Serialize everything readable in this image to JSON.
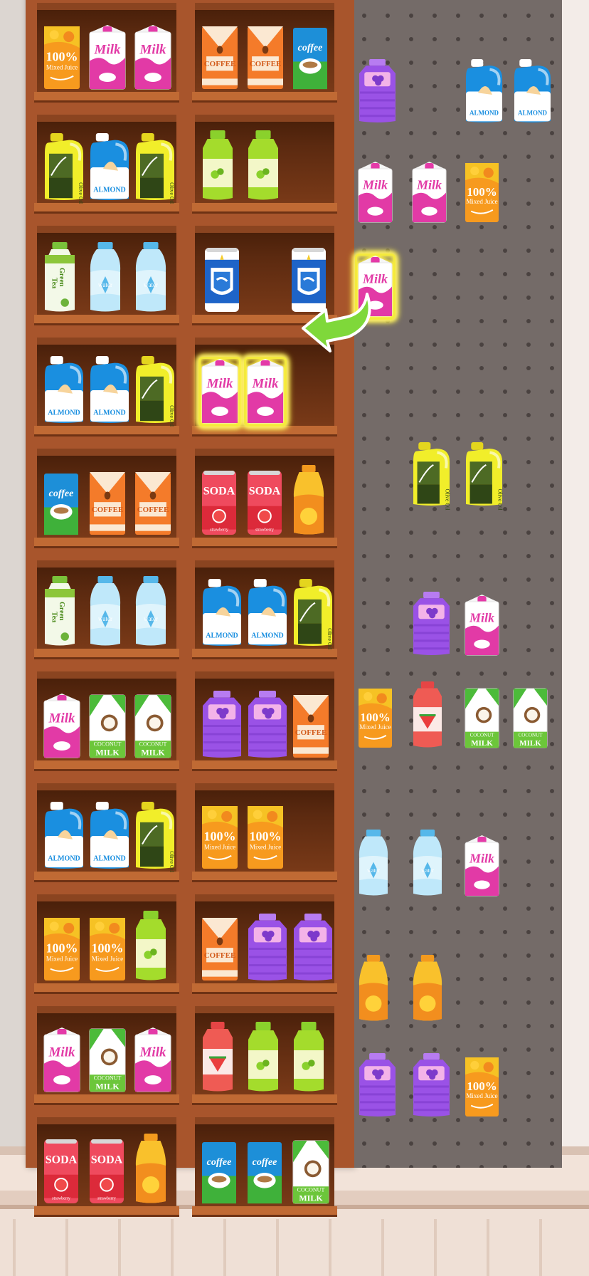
{
  "scene": {
    "name": "grocery-shelf-sort-game",
    "hint": {
      "from": "pegboard-slot-4-1",
      "to": "cabinet-shelf-4-right"
    }
  },
  "colors": {
    "wall": "#e8e2dd",
    "wood": "#a8552c",
    "wood_dark": "#6e3214",
    "wood_inner": "#5c2a10",
    "pegboard": "#746b68",
    "peg_hole": "#4a4240",
    "floor": "#efdfd4",
    "highlight": "#f4ea3c",
    "hint_arrow": "#7fd83a"
  },
  "products": {
    "milk": {
      "label": "Milk",
      "kind": "carton"
    },
    "juice": {
      "label": "100%",
      "sub": "Mixed Juice",
      "kind": "carton"
    },
    "coffee_box": {
      "label": "COFFEE",
      "kind": "carton"
    },
    "coffee_can": {
      "label": "coffee",
      "kind": "box"
    },
    "almond": {
      "label": "ALMOND",
      "kind": "jug"
    },
    "olive_oil": {
      "label": "Olive Oil",
      "kind": "jug"
    },
    "green_juice": {
      "label": "",
      "kind": "bottle"
    },
    "green_tea": {
      "label": "Green Tea",
      "kind": "bottle"
    },
    "water": {
      "label": "water",
      "kind": "bottle"
    },
    "soda": {
      "label": "SODA",
      "sub": "strawberry",
      "kind": "can"
    },
    "energy": {
      "label": "",
      "kind": "can"
    },
    "coconut": {
      "label": "COCONUT MILK",
      "kind": "carton"
    },
    "grape": {
      "label": "",
      "kind": "jug"
    },
    "watermelon": {
      "label": "",
      "kind": "bottle"
    },
    "mango_bottle": {
      "label": "",
      "kind": "bottle"
    }
  },
  "cabinet": {
    "rows": [
      {
        "left": [
          "juice",
          "milk",
          "milk"
        ],
        "right": [
          "coffee_box",
          "coffee_box",
          "coffee_can"
        ]
      },
      {
        "left": [
          "olive_oil",
          "almond",
          "olive_oil"
        ],
        "right": [
          "green_juice",
          "green_juice"
        ]
      },
      {
        "left": [
          "green_tea",
          "water",
          "water"
        ],
        "right": [
          "energy",
          "energy"
        ],
        "right_layout": "split"
      },
      {
        "left": [
          "almond",
          "almond",
          "olive_oil"
        ],
        "right": [
          "milk",
          "milk"
        ],
        "right_highlight": true
      },
      {
        "left": [
          "coffee_can",
          "coffee_box",
          "coffee_box"
        ],
        "right": [
          "soda",
          "soda",
          "mango_bottle"
        ]
      },
      {
        "left": [
          "green_tea",
          "water",
          "water"
        ],
        "right": [
          "almond",
          "almond",
          "olive_oil"
        ]
      },
      {
        "left": [
          "milk",
          "coconut",
          "coconut"
        ],
        "right": [
          "grape",
          "grape",
          "coffee_box"
        ]
      },
      {
        "left": [
          "almond",
          "almond",
          "olive_oil"
        ],
        "right": [
          "juice",
          "juice"
        ]
      },
      {
        "left": [
          "juice",
          "juice",
          "green_juice"
        ],
        "right": [
          "coffee_box",
          "grape",
          "grape"
        ]
      },
      {
        "left": [
          "milk",
          "coconut",
          "milk"
        ],
        "right": [
          "watermelon",
          "green_juice",
          "green_juice"
        ]
      },
      {
        "left": [
          "soda",
          "soda",
          "mango_bottle"
        ],
        "right": [
          "coffee_can",
          "coffee_can",
          "coconut"
        ]
      }
    ]
  },
  "pegboard": {
    "slots": [
      {
        "type": "grape",
        "col": 0,
        "row": 0
      },
      {
        "type": "almond",
        "col": 2,
        "row": 0
      },
      {
        "type": "almond",
        "col": 3,
        "row": 0
      },
      {
        "type": "milk",
        "col": 0,
        "row": 1
      },
      {
        "type": "milk",
        "col": 1,
        "row": 1
      },
      {
        "type": "juice",
        "col": 2,
        "row": 1
      },
      {
        "type": "milk",
        "col": 0,
        "row": 2,
        "highlight": true
      },
      {
        "type": "olive_oil",
        "col": 1,
        "row": 4
      },
      {
        "type": "olive_oil",
        "col": 2,
        "row": 4
      },
      {
        "type": "grape",
        "col": 1,
        "row": 6
      },
      {
        "type": "milk",
        "col": 2,
        "row": 6
      },
      {
        "type": "juice",
        "col": 0,
        "row": 7
      },
      {
        "type": "watermelon",
        "col": 1,
        "row": 7
      },
      {
        "type": "coconut",
        "col": 2,
        "row": 7
      },
      {
        "type": "coconut",
        "col": 3,
        "row": 7
      },
      {
        "type": "water",
        "col": 0,
        "row": 8
      },
      {
        "type": "water",
        "col": 1,
        "row": 8
      },
      {
        "type": "milk",
        "col": 2,
        "row": 8
      },
      {
        "type": "mango_bottle",
        "col": 0,
        "row": 9
      },
      {
        "type": "mango_bottle",
        "col": 1,
        "row": 9
      },
      {
        "type": "grape",
        "col": 0,
        "row": 10
      },
      {
        "type": "grape",
        "col": 1,
        "row": 10
      },
      {
        "type": "juice",
        "col": 2,
        "row": 10
      }
    ]
  }
}
